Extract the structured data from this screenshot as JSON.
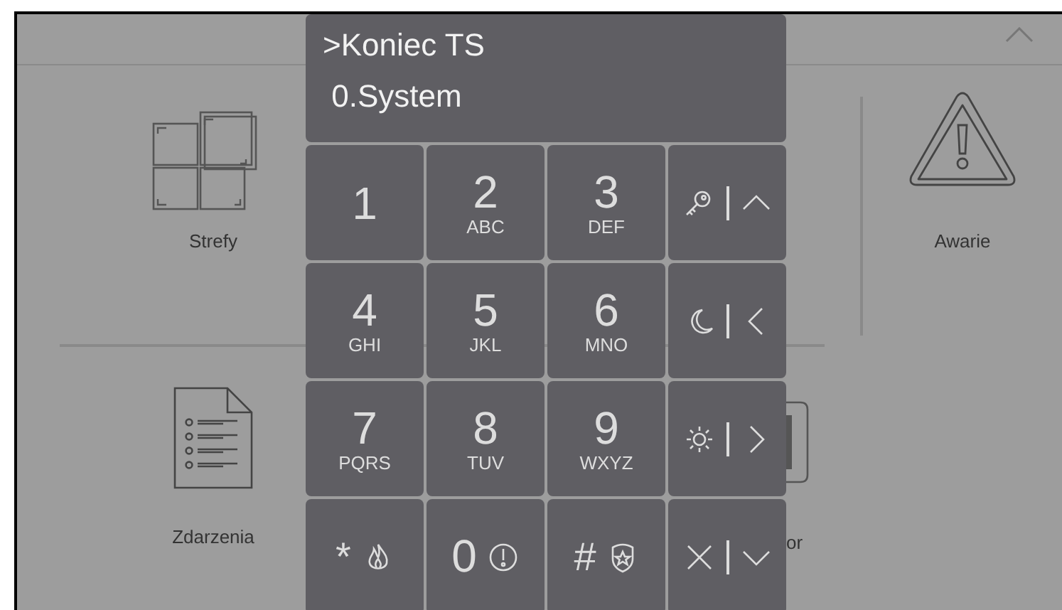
{
  "menu": {
    "items": [
      {
        "label": "Strefy",
        "kind": "zones"
      },
      {
        "label": "Awarie",
        "kind": "faults"
      },
      {
        "label": "Zdarzenia",
        "kind": "events"
      },
      {
        "label": "or",
        "kind": "partial"
      }
    ]
  },
  "keypad": {
    "display": [
      ">Koniec TS",
      " 0.System"
    ],
    "keys": [
      {
        "kind": "digit",
        "digit": "1"
      },
      {
        "kind": "digit",
        "digit": "2",
        "letters": "ABC"
      },
      {
        "kind": "digit",
        "digit": "3",
        "letters": "DEF"
      },
      {
        "kind": "function"
      },
      {
        "kind": "digit",
        "digit": "4",
        "letters": "GHI"
      },
      {
        "kind": "digit",
        "digit": "5",
        "letters": "JKL"
      },
      {
        "kind": "digit",
        "digit": "6",
        "letters": "MNO"
      },
      {
        "kind": "function"
      },
      {
        "kind": "digit",
        "digit": "7",
        "letters": "PQRS"
      },
      {
        "kind": "digit",
        "digit": "8",
        "letters": "TUV"
      },
      {
        "kind": "digit",
        "digit": "9",
        "letters": "WXYZ"
      },
      {
        "kind": "function"
      },
      {
        "kind": "symbol",
        "symbol": "*"
      },
      {
        "kind": "symbol",
        "symbol": "0"
      },
      {
        "kind": "symbol",
        "symbol": "#"
      },
      {
        "kind": "function"
      }
    ]
  }
}
